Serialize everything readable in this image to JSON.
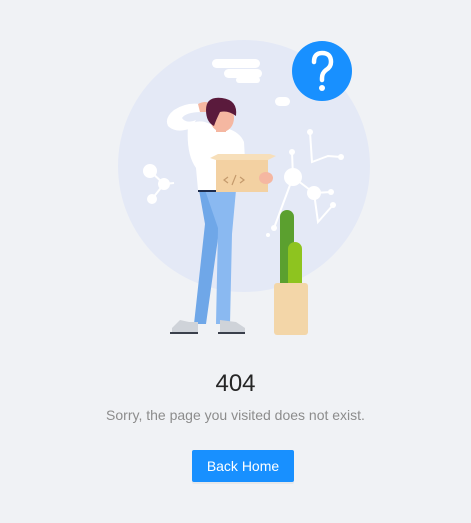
{
  "result": {
    "title": "404",
    "subtitle": "Sorry, the page you visited does not exist.",
    "status_icon": "question-mark-icon"
  },
  "actions": {
    "back_home_label": "Back Home"
  },
  "colors": {
    "background": "#f0f2f5",
    "primary": "#1890ff",
    "circle_bg": "#e4e9f6",
    "title": "#262626",
    "subtitle": "#8c8c8c"
  }
}
